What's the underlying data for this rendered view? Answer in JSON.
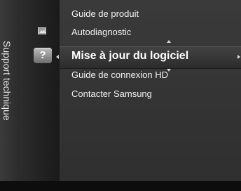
{
  "side_label": "Support technique",
  "menu_items": [
    "Guide de produit",
    "Autodiagnostic",
    "Mise à jour du logiciel",
    "Guide de connexion HD",
    "Contacter Samsung"
  ],
  "selected_index": 2,
  "icons": {
    "help": "?",
    "picture": "picture-icon"
  },
  "colors": {
    "background": "#141414",
    "panel": "#353535",
    "text": "#f2f2f2"
  }
}
